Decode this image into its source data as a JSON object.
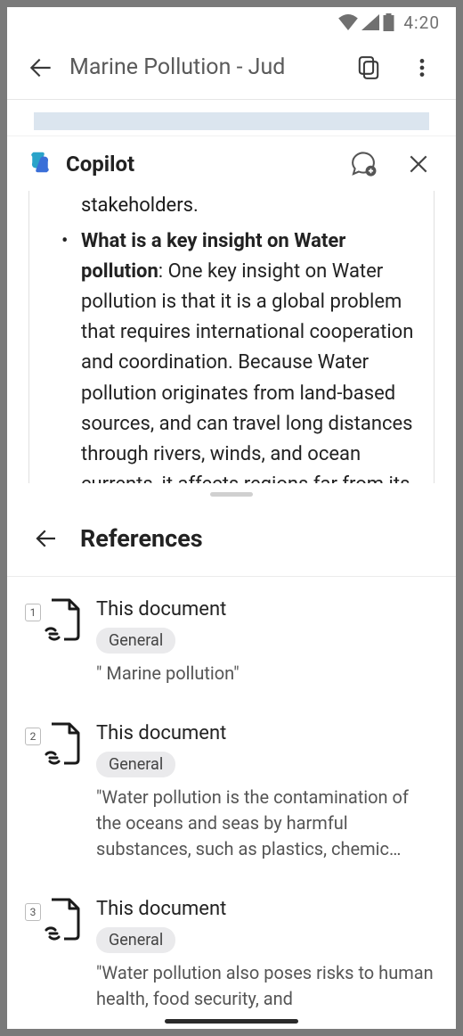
{
  "status": {
    "time": "4:20"
  },
  "appbar": {
    "title": "Marine Pollution - Jud"
  },
  "copilot": {
    "title": "Copilot"
  },
  "chat": {
    "frag_prev": "stakeholders.",
    "bullet_bold": "What is a key insight on Water pollution",
    "bullet_rest": ": One key insight on Water pollution is that it is a global problem that requires international cooperation and coordination. Because Water pollution originates from land-based sources, and can travel long distances through rivers, winds, and ocean currents, it affects regions far from its"
  },
  "refs": {
    "title": "References",
    "items": [
      {
        "num": "1",
        "title": "This document",
        "badge": "General",
        "snip": "\" Marine pollution\""
      },
      {
        "num": "2",
        "title": "This document",
        "badge": "General",
        "snip": "\"Water pollution is the contamination of the oceans and seas by harmful substances, such as plastics, chemic…"
      },
      {
        "num": "3",
        "title": "This document",
        "badge": "General",
        "snip": "\"Water pollution also poses risks to human health, food security, and"
      }
    ]
  }
}
